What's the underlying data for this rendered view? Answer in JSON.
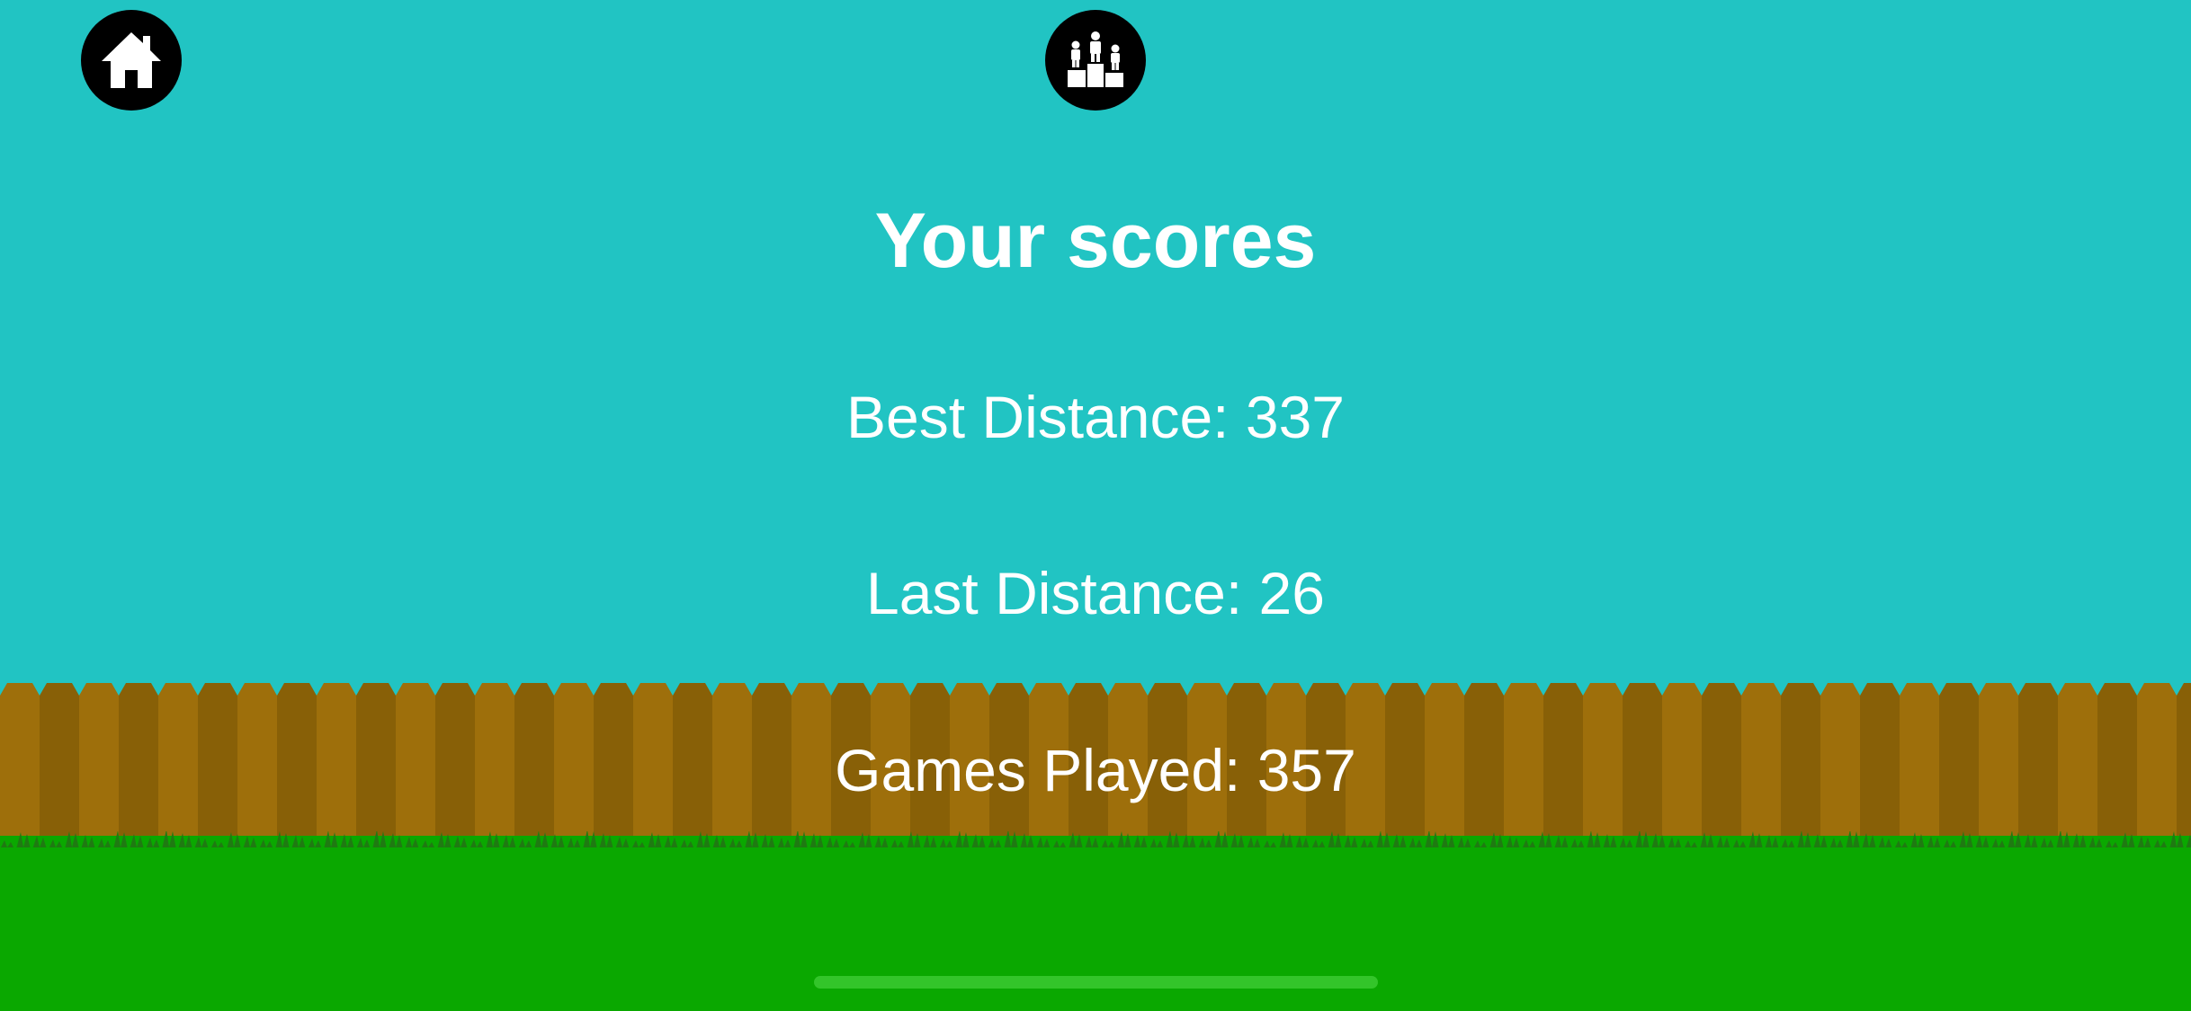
{
  "scores": {
    "title": "Your scores",
    "best_distance": "Best Distance: 337",
    "last_distance": "Last Distance: 26",
    "games_played": "Games Played: 357"
  },
  "icons": {
    "home": "home-icon",
    "leaderboard": "podium-icon"
  },
  "colors": {
    "sky": "#21c4c3",
    "fence_light": "#9e6f0b",
    "fence_dark": "#886007",
    "grass": "#0aa800",
    "grass_dark": "#1f7a12",
    "button_bg": "#000000",
    "text": "#ffffff"
  }
}
